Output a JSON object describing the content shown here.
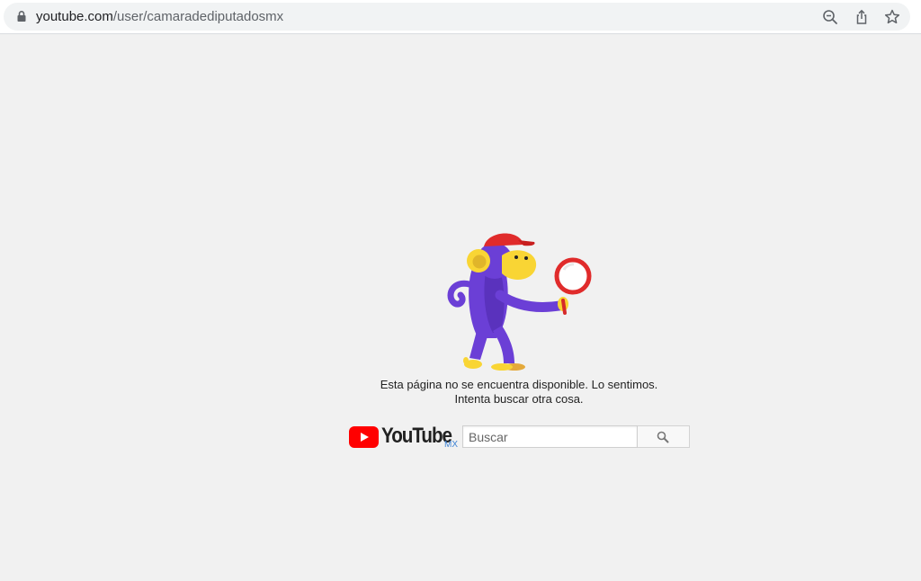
{
  "browser": {
    "url_domain": "youtube.com",
    "url_path": "/user/camaradediputadosmx",
    "icons": [
      "lock-icon",
      "zoom-icon",
      "share-icon",
      "bookmark-star-icon"
    ]
  },
  "page": {
    "illustration": "monkey-with-magnifying-glass",
    "message_line1": "Esta página no se encuentra disponible. Lo sentimos.",
    "message_line2": "Intenta buscar otra cosa.",
    "logo_text": "YouTube",
    "logo_country": "MX",
    "search_placeholder": "Buscar",
    "search_value": ""
  },
  "colors": {
    "youtube_red": "#ff0000",
    "background": "#f1f1f1",
    "monkey_purple": "#6b3fd6",
    "monkey_yellow": "#f9d534",
    "cap_red": "#e02b2b",
    "country_blue": "#3e83d4"
  }
}
